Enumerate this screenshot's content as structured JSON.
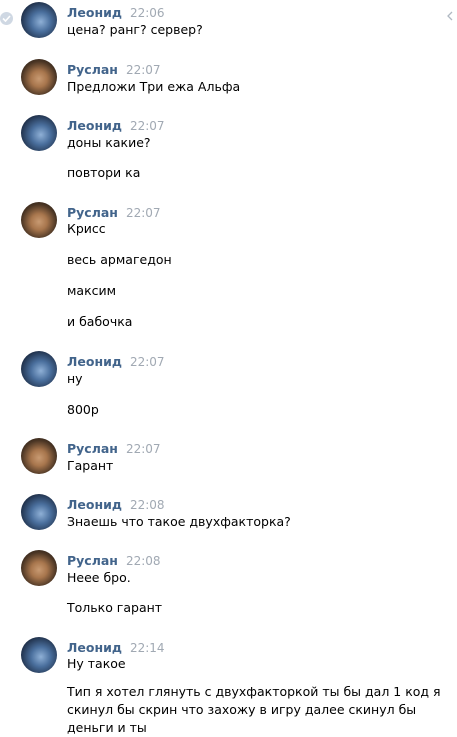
{
  "messages": [
    {
      "author": "Леонид",
      "time": "22:06",
      "lines": [
        "цена? ранг? сервер?"
      ]
    },
    {
      "author": "Руслан",
      "time": "22:07",
      "lines": [
        "Предложи Три ежа Альфа"
      ]
    },
    {
      "author": "Леонид",
      "time": "22:07",
      "lines": [
        "доны какие?",
        "повтори ка"
      ]
    },
    {
      "author": "Руслан",
      "time": "22:07",
      "lines": [
        "Крисс",
        "весь армагедон",
        "максим",
        "и бабочка"
      ]
    },
    {
      "author": "Леонид",
      "time": "22:07",
      "lines": [
        "ну",
        "800р"
      ]
    },
    {
      "author": "Руслан",
      "time": "22:07",
      "lines": [
        "Гарант"
      ]
    },
    {
      "author": "Леонид",
      "time": "22:08",
      "lines": [
        "Знаешь что такое двухфакторка?"
      ]
    },
    {
      "author": "Руслан",
      "time": "22:08",
      "lines": [
        "Неее бро.",
        "Только гарант"
      ]
    },
    {
      "author": "Леонид",
      "time": "22:14",
      "lines": [
        "Ну такое",
        "Тип я хотел глянуть с двухфакторкой ты бы дал 1 код я скинул бы скрин что захожу в игру далее скинул бы деньги и ты"
      ]
    }
  ]
}
